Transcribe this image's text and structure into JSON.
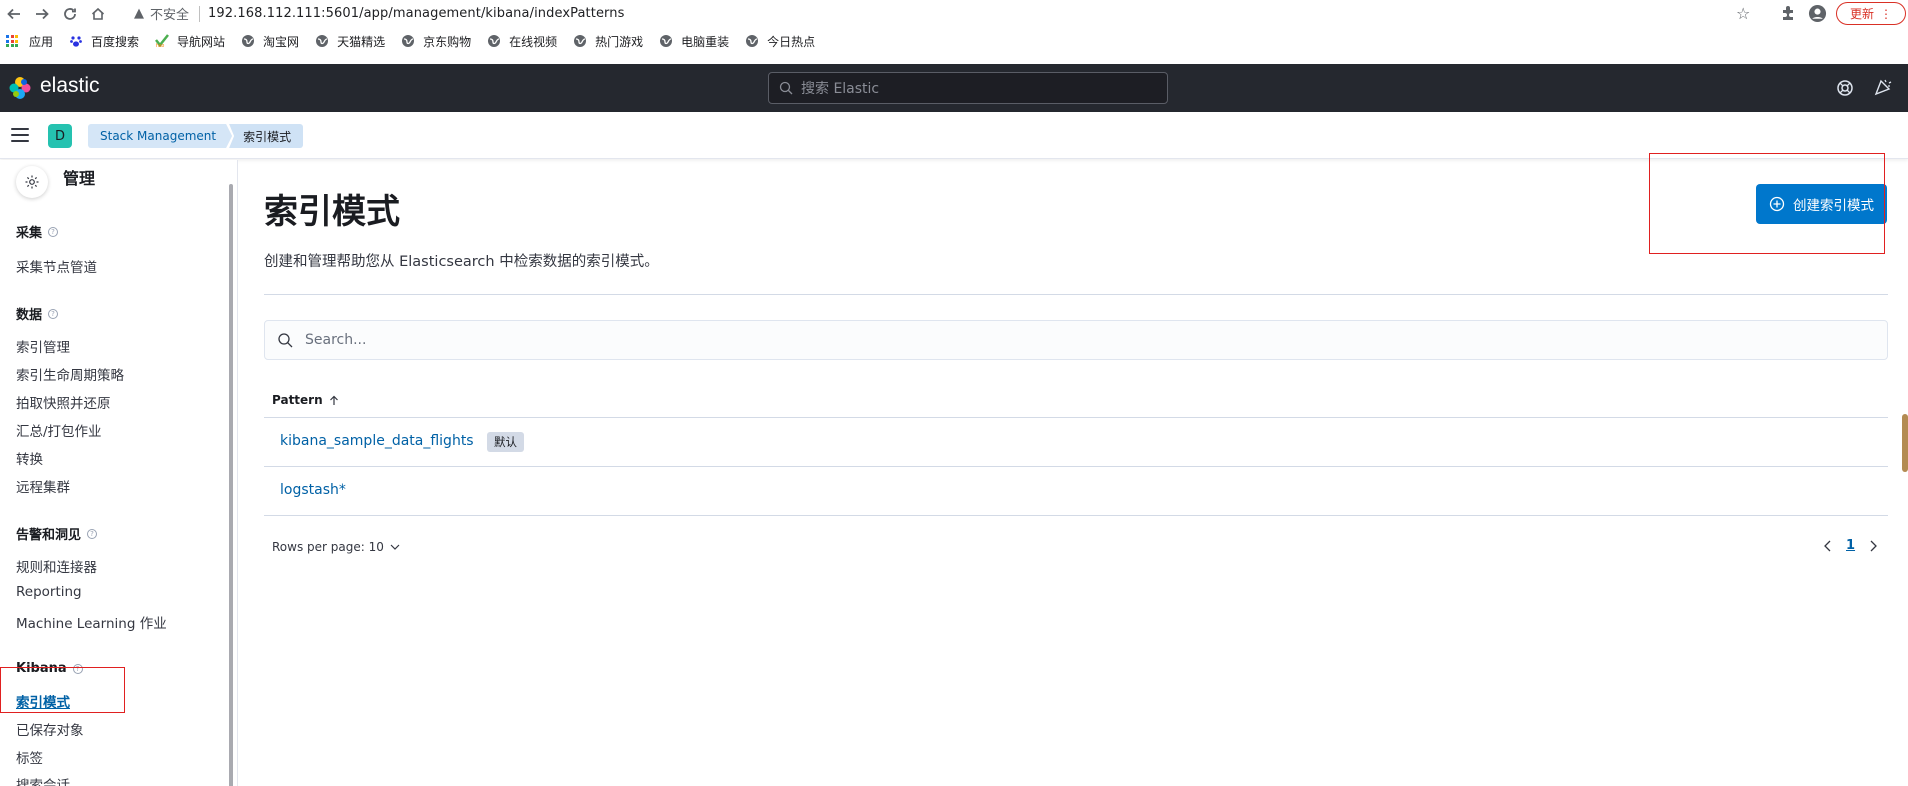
{
  "browser": {
    "insecure_label": "不安全",
    "url": "192.168.112.111:5601/app/management/kibana/indexPatterns",
    "update_label": "更新",
    "bookmarks": [
      {
        "label": "应用"
      },
      {
        "label": "百度搜索"
      },
      {
        "label": "导航网站"
      },
      {
        "label": "淘宝网"
      },
      {
        "label": "天猫精选"
      },
      {
        "label": "京东购物"
      },
      {
        "label": "在线视频"
      },
      {
        "label": "热门游戏"
      },
      {
        "label": "电脑重装"
      },
      {
        "label": "今日热点"
      }
    ]
  },
  "header": {
    "brand": "elastic",
    "search_placeholder": "搜索 Elastic"
  },
  "breadcrumb": {
    "space_initial": "D",
    "items": [
      "Stack Management",
      "索引模式"
    ]
  },
  "sidebar": {
    "title": "管理",
    "groups": [
      {
        "title": "采集",
        "items": [
          "采集节点管道"
        ]
      },
      {
        "title": "数据",
        "items": [
          "索引管理",
          "索引生命周期策略",
          "拍取快照并还原",
          "汇总/打包作业",
          "转换",
          "远程集群"
        ]
      },
      {
        "title": "告警和洞见",
        "items": [
          "规则和连接器",
          "Reporting",
          "Machine Learning 作业"
        ]
      },
      {
        "title": "Kibana",
        "items": [
          "索引模式",
          "已保存对象",
          "标签",
          "搜索会话"
        ]
      }
    ],
    "active_item": "索引模式"
  },
  "main": {
    "title": "索引模式",
    "description": "创建和管理帮助您从 Elasticsearch 中检索数据的索引模式。",
    "create_button": "创建索引模式",
    "search_placeholder": "Search...",
    "table": {
      "column": "Pattern",
      "rows": [
        {
          "pattern": "kibana_sample_data_flights",
          "badge": "默认"
        },
        {
          "pattern": "logstash*",
          "badge": ""
        }
      ]
    },
    "rows_per_page": "Rows per page: 10",
    "current_page": "1"
  },
  "colors": {
    "header_bg": "#25282f",
    "primary": "#0077cc",
    "link": "#0061a6",
    "annotation": "#e02020"
  }
}
